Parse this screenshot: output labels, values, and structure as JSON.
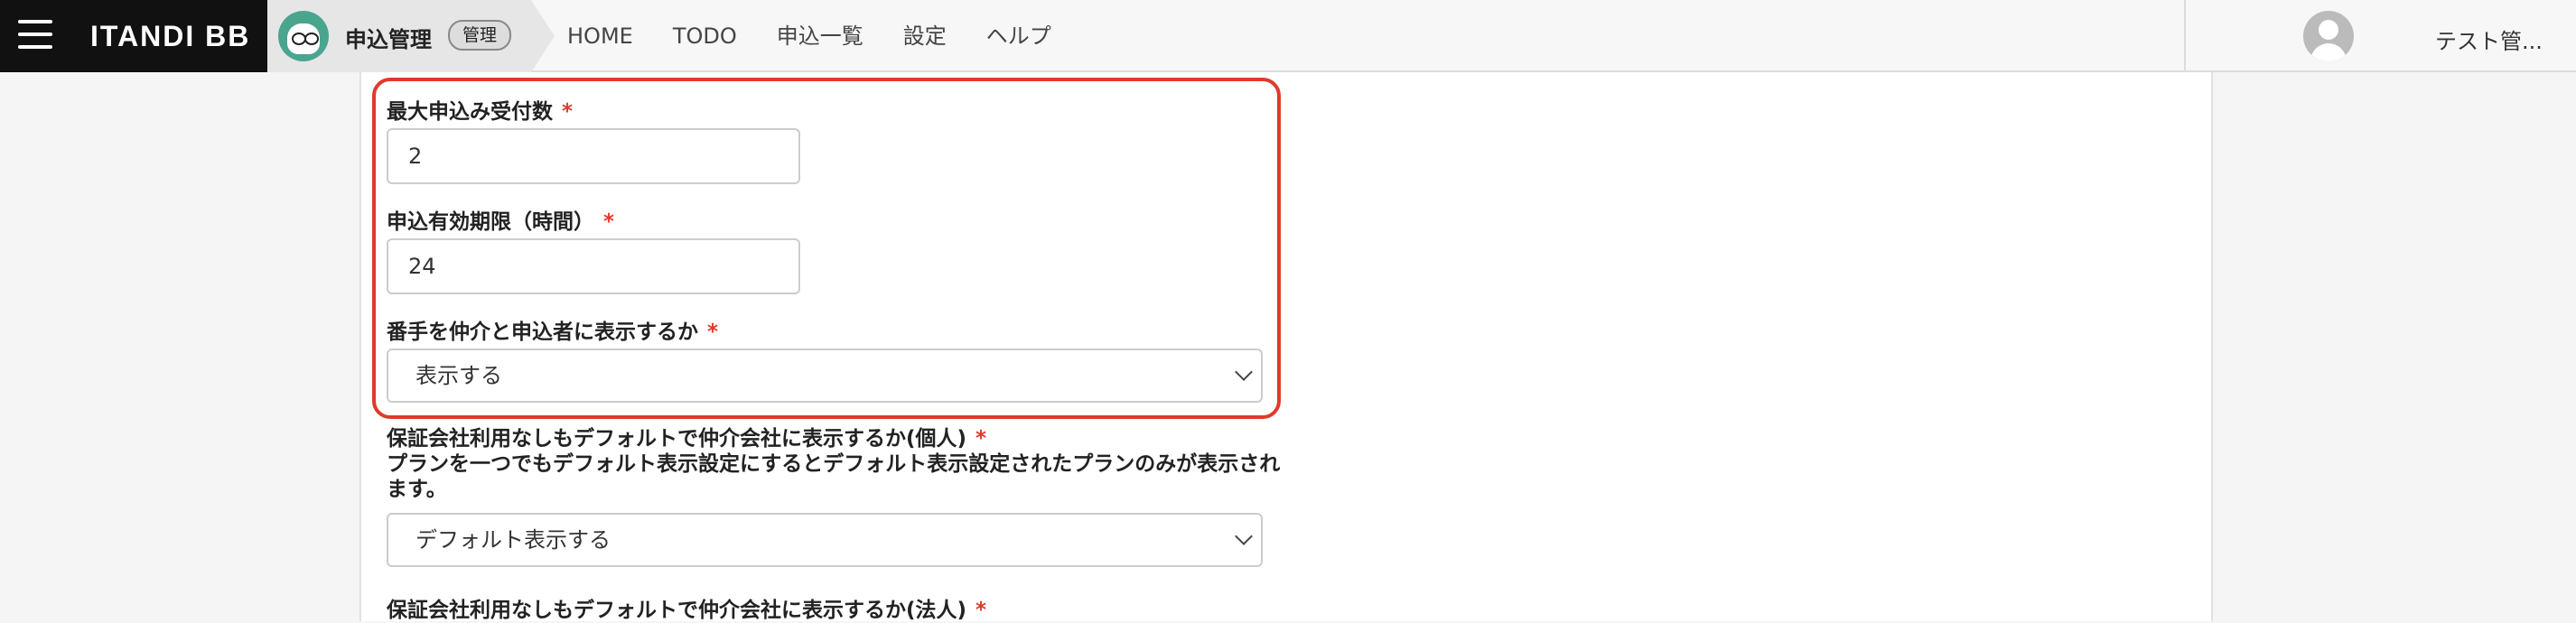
{
  "brand": {
    "logo": "ITANDI BB"
  },
  "app": {
    "name": "申込管理",
    "badge": "管理"
  },
  "nav": [
    {
      "label": "HOME"
    },
    {
      "label": "TODO"
    },
    {
      "label": "申込一覧"
    },
    {
      "label": "設定"
    },
    {
      "label": "ヘルプ"
    }
  ],
  "user": {
    "name": "テスト管..."
  },
  "form": {
    "max_applications": {
      "label": "最大申込み受付数",
      "required_mark": "*",
      "value": "2"
    },
    "validity_hours": {
      "label": "申込有効期限（時間）",
      "required_mark": "*",
      "value": "24"
    },
    "show_order": {
      "label": "番手を仲介と申込者に表示するか",
      "required_mark": "*",
      "selected": "表示する"
    },
    "guarantor_individual": {
      "label": "保証会社利用なしもデフォルトで仲介会社に表示するか(個人)",
      "required_mark": "*",
      "note": "プランを一つでもデフォルト表示設定にするとデフォルト表示設定されたプランのみが表示されます。",
      "selected": "デフォルト表示する"
    },
    "guarantor_corporate": {
      "label": "保証会社利用なしもデフォルトで仲介会社に表示するか(法人)",
      "required_mark": "*"
    }
  },
  "colors": {
    "highlight": "#e03a2a",
    "brand_bg": "#111111",
    "avatar_green": "#4aa58f"
  }
}
